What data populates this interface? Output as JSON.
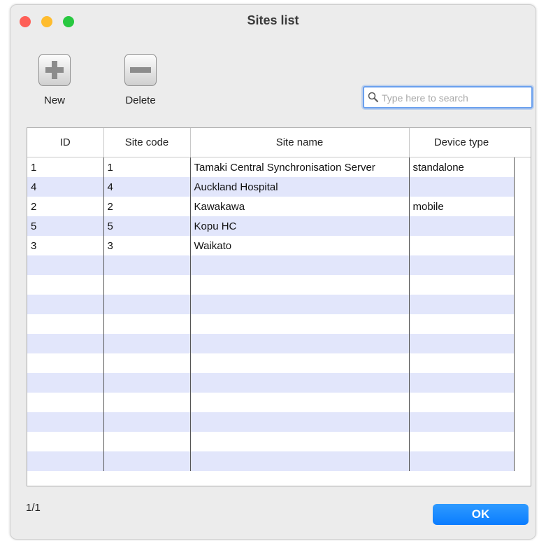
{
  "window": {
    "title": "Sites list"
  },
  "toolbar": {
    "new_label": "New",
    "delete_label": "Delete"
  },
  "search": {
    "placeholder": "Type here to search",
    "value": ""
  },
  "table": {
    "columns": [
      "ID",
      "Site code",
      "Site name",
      "Device type"
    ],
    "rows": [
      [
        "1",
        "1",
        "Tamaki Central Synchronisation Server",
        "standalone"
      ],
      [
        "4",
        "4",
        "Auckland Hospital",
        ""
      ],
      [
        "2",
        "2",
        "Kawakawa",
        "mobile"
      ],
      [
        "5",
        "5",
        "Kopu HC",
        ""
      ],
      [
        "3",
        "3",
        "Waikato",
        ""
      ]
    ]
  },
  "footer": {
    "page_indicator": "1/1",
    "ok_label": "OK"
  },
  "colors": {
    "accent": "#0a7cff",
    "row_alt": "#e2e6fb",
    "close": "#fe5f57",
    "minimize": "#febc2e",
    "maximize": "#28c840"
  }
}
